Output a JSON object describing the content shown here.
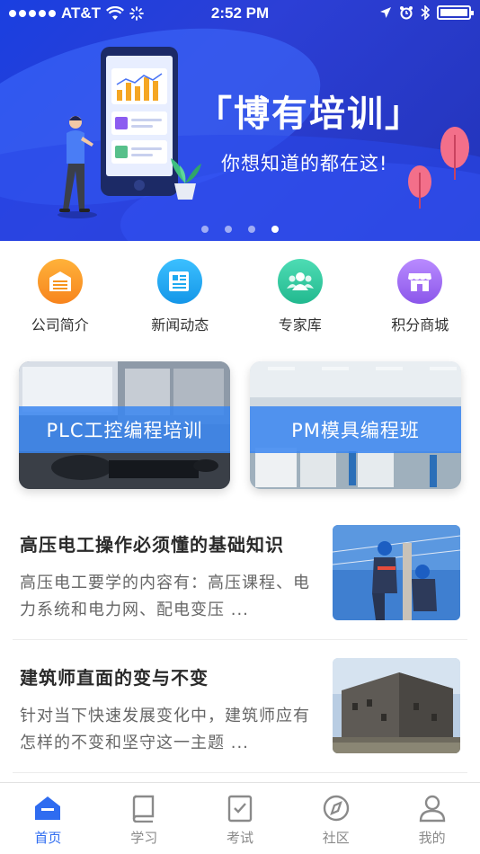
{
  "status_bar": {
    "carrier": "AT&T",
    "time": "2:52 PM"
  },
  "banner": {
    "title": "「博有培训」",
    "subtitle": "你想知道的都在这!",
    "page_count": 4,
    "active_page": 4
  },
  "quick_menu": [
    {
      "label": "公司简介",
      "icon": "company-icon",
      "color": "#f7941d"
    },
    {
      "label": "新闻动态",
      "icon": "news-icon",
      "color": "#1ea9f0"
    },
    {
      "label": "专家库",
      "icon": "experts-icon",
      "color": "#2fc9a0"
    },
    {
      "label": "积分商城",
      "icon": "store-icon",
      "color": "#a06cf2"
    }
  ],
  "courses": [
    {
      "label": "PLC工控编程培训"
    },
    {
      "label": "PM模具编程班"
    }
  ],
  "articles": [
    {
      "title": "高压电工操作必须懂的基础知识",
      "summary": "高压电工要学的内容有：高压课程、电力系统和电力网、配电变压 ..."
    },
    {
      "title": "建筑师直面的变与不变",
      "summary": "针对当下快速发展变化中，建筑师应有怎样的不变和坚守这一主题 ..."
    }
  ],
  "tabbar": {
    "items": [
      {
        "label": "首页",
        "icon": "home-icon",
        "active": true
      },
      {
        "label": "学习",
        "icon": "book-icon",
        "active": false
      },
      {
        "label": "考试",
        "icon": "exam-icon",
        "active": false
      },
      {
        "label": "社区",
        "icon": "compass-icon",
        "active": false
      },
      {
        "label": "我的",
        "icon": "profile-icon",
        "active": false
      }
    ],
    "active_color": "#2f6cf0",
    "inactive_color": "#8a8a8a"
  }
}
